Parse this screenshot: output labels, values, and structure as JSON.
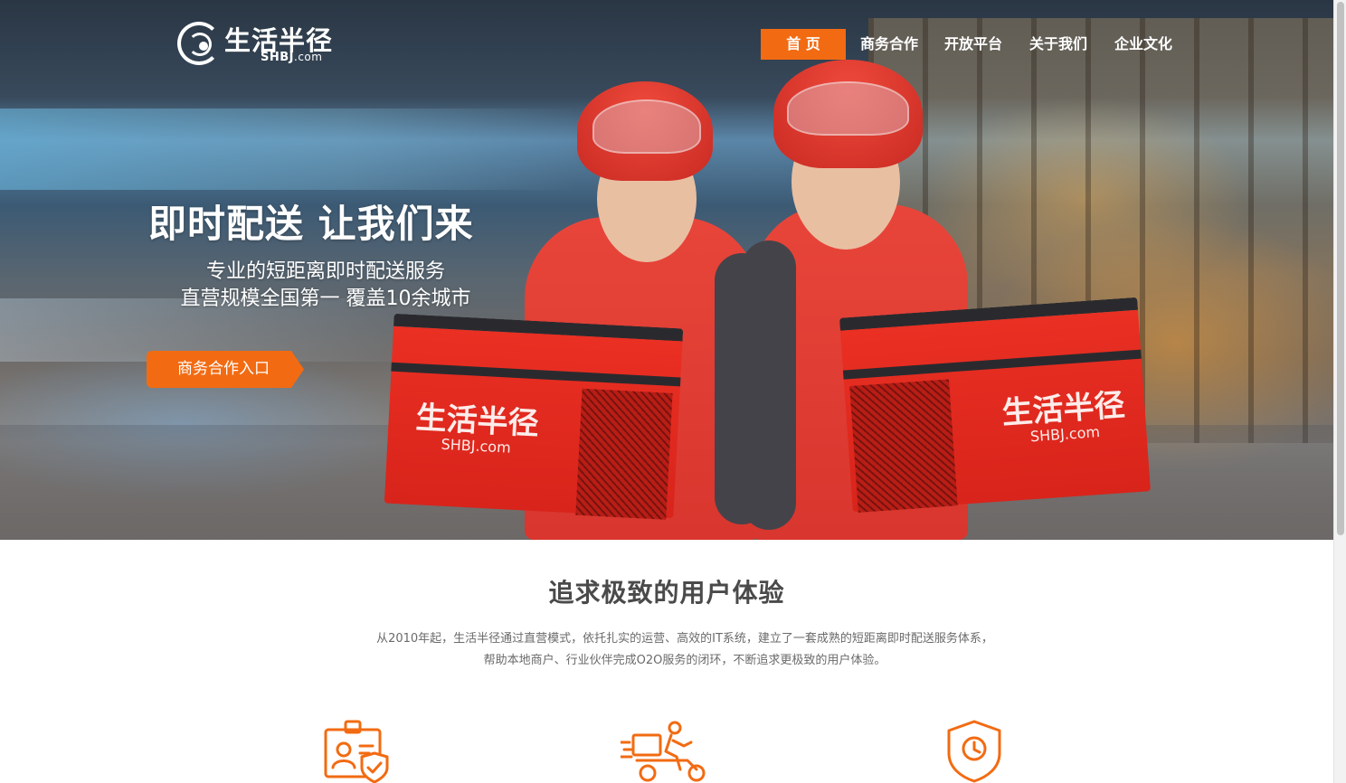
{
  "site": {
    "logo": {
      "cn": "生活半径",
      "en_main": "SHBJ",
      "en_suffix": ".com"
    }
  },
  "nav": {
    "items": [
      {
        "label": "首 页",
        "active": true
      },
      {
        "label": "商务合作",
        "active": false
      },
      {
        "label": "开放平台",
        "active": false
      },
      {
        "label": "关于我们",
        "active": false
      },
      {
        "label": "企业文化",
        "active": false
      }
    ]
  },
  "hero": {
    "title": "即时配送 让我们来",
    "subtitle_line1": "专业的短距离即时配送服务",
    "subtitle_line2": "直营规模全国第一   覆盖10余城市",
    "cta_label": "商务合作入口",
    "bag_brand_cn": "生活半径",
    "bag_brand_en": "SHBJ.com"
  },
  "section": {
    "title": "追求极致的用户体验",
    "desc_line1": "从2010年起，生活半径通过直营模式，依托扎实的运营、高效的IT系统，建立了一套成熟的短距离即时配送服务体系，",
    "desc_line2": "帮助本地商户、行业伙伴完成O2O服务的闭环，不断追求更极致的用户体验。"
  },
  "features": [
    {
      "icon": "verified-id-card-icon"
    },
    {
      "icon": "delivery-scooter-icon"
    },
    {
      "icon": "shield-clock-icon"
    }
  ],
  "colors": {
    "accent": "#f26b12",
    "heading": "#4a4a4a",
    "body_text": "#6a6a6a",
    "white": "#ffffff"
  }
}
